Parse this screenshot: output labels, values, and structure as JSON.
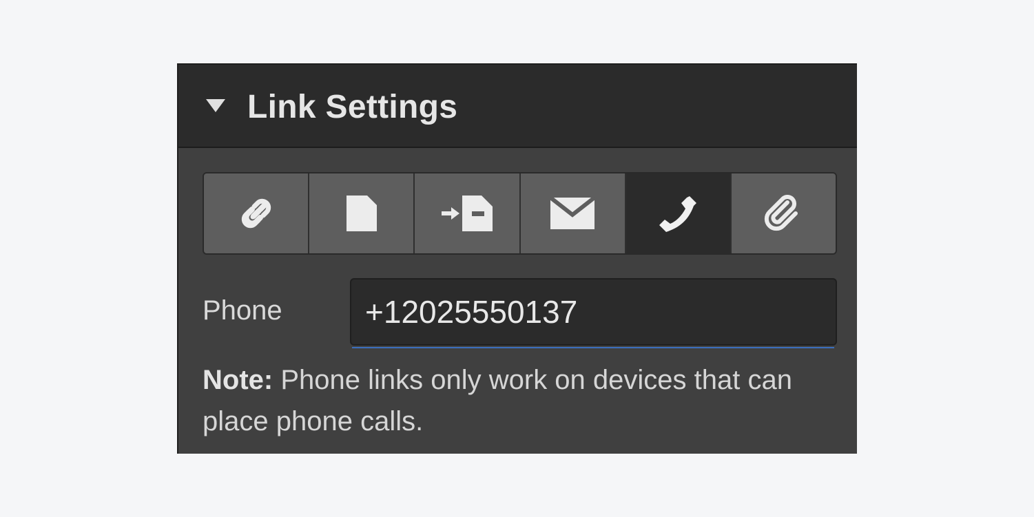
{
  "panel": {
    "title": "Link Settings",
    "expanded": true
  },
  "link_types": [
    {
      "name": "url",
      "icon": "link-icon",
      "active": false
    },
    {
      "name": "page",
      "icon": "page-icon",
      "active": false
    },
    {
      "name": "page-section",
      "icon": "section-icon",
      "active": false
    },
    {
      "name": "email",
      "icon": "email-icon",
      "active": false
    },
    {
      "name": "phone",
      "icon": "phone-icon",
      "active": true
    },
    {
      "name": "file",
      "icon": "paperclip-icon",
      "active": false
    }
  ],
  "phone_field": {
    "label": "Phone",
    "value": "+12025550137"
  },
  "note": {
    "prefix": "Note:",
    "text": " Phone links only work on devices that can place phone calls."
  },
  "colors": {
    "page_background": "#f5f6f8",
    "panel_background": "#404040",
    "header_background": "#2b2b2b",
    "segment_background": "#5e5e5e",
    "segment_active": "#2b2b2b",
    "focus_accent": "#3b6fbf",
    "icon_color": "#ececec"
  }
}
